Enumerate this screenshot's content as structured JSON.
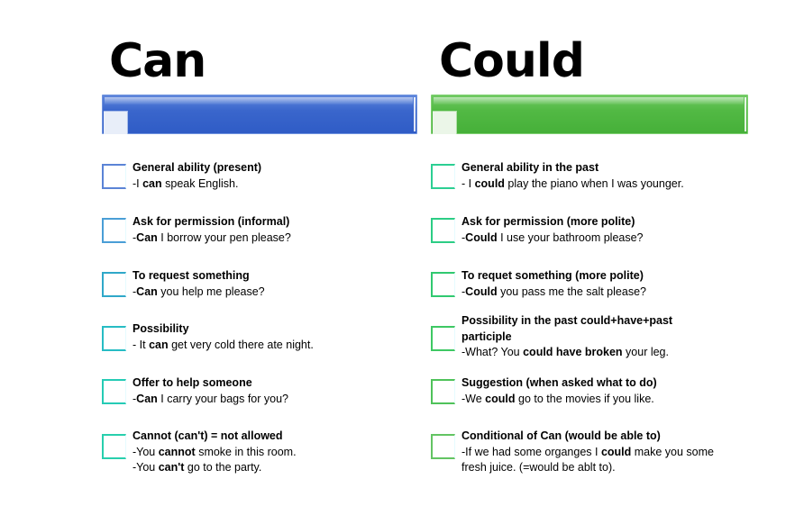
{
  "headings": {
    "can": "Can",
    "could": "Could"
  },
  "colors": {
    "can_bar": "#3a66cc",
    "could_bar": "#52b944"
  },
  "can": {
    "items": [
      {
        "title": "General ability (present)",
        "examples": [
          [
            {
              "t": "-I "
            },
            {
              "t": "can",
              "b": true
            },
            {
              "t": " speak English."
            }
          ]
        ],
        "border": "#5b84d6"
      },
      {
        "title": "Ask for permission (informal)",
        "examples": [
          [
            {
              "t": "-"
            },
            {
              "t": "Can",
              "b": true
            },
            {
              "t": " I borrow your pen please?"
            }
          ]
        ],
        "border": "#4a9ed6"
      },
      {
        "title": "To request something",
        "examples": [
          [
            {
              "t": "-"
            },
            {
              "t": "Can",
              "b": true
            },
            {
              "t": " you help me please?"
            }
          ]
        ],
        "border": "#2fa8c9"
      },
      {
        "title": "Possibility",
        "examples": [
          [
            {
              "t": "- It "
            },
            {
              "t": "can",
              "b": true
            },
            {
              "t": " get very cold there ate night."
            }
          ]
        ],
        "border": "#27bcc4"
      },
      {
        "title": "Offer to help someone",
        "examples": [
          [
            {
              "t": "-"
            },
            {
              "t": "Can",
              "b": true
            },
            {
              "t": " I carry your bags for you?"
            }
          ]
        ],
        "border": "#25cbb5"
      },
      {
        "title": "Cannot (can't) = not allowed",
        "examples": [
          [
            {
              "t": "-You "
            },
            {
              "t": "cannot",
              "b": true
            },
            {
              "t": " smoke in this room."
            }
          ],
          [
            {
              "t": "-You "
            },
            {
              "t": "can't",
              "b": true
            },
            {
              "t": " go to the party."
            }
          ]
        ],
        "border": "#28cfad"
      }
    ]
  },
  "could": {
    "items": [
      {
        "title": "General ability in the past",
        "examples": [
          [
            {
              "t": "- I "
            },
            {
              "t": "could",
              "b": true
            },
            {
              "t": " play the piano when I was younger."
            }
          ]
        ],
        "border": "#2ccf93"
      },
      {
        "title": "Ask for permission (more polite)",
        "examples": [
          [
            {
              "t": "-"
            },
            {
              "t": "Could",
              "b": true
            },
            {
              "t": " I use your bathroom please?"
            }
          ]
        ],
        "border": "#2ccd85"
      },
      {
        "title": "To requet something (more polite)",
        "examples": [
          [
            {
              "t": "-"
            },
            {
              "t": "Could",
              "b": true
            },
            {
              "t": " you pass me the salt please?"
            }
          ]
        ],
        "border": "#30c970"
      },
      {
        "title": "Possibility in the past could+have+past",
        "title2": "participle",
        "examples": [
          [
            {
              "t": "-What? You "
            },
            {
              "t": "could have broken",
              "b": true
            },
            {
              "t": " your leg."
            }
          ]
        ],
        "border": "#3ec863"
      },
      {
        "title": "Suggestion (when asked what to do)",
        "examples": [
          [
            {
              "t": "-We "
            },
            {
              "t": "could",
              "b": true
            },
            {
              "t": " go to the movies if you like."
            }
          ]
        ],
        "border": "#4fc25a"
      },
      {
        "title": "Conditional of Can (would be able  to)",
        "examples": [
          [
            {
              "t": "-If we had some organges I "
            },
            {
              "t": "could",
              "b": true
            },
            {
              "t": " make you some"
            }
          ],
          [
            {
              "t": "fresh juice. (=would be ablt to)."
            }
          ]
        ],
        "border": "#63c463"
      }
    ]
  }
}
